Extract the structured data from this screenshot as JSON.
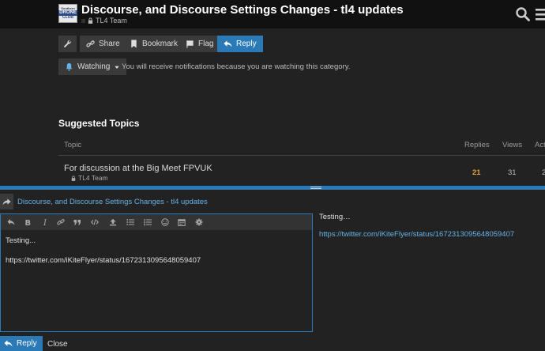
{
  "header": {
    "logo_lines": [
      "Southern",
      "DRONE",
      "CLUB"
    ],
    "title": "Discourse, and Discourse Settings Changes - tl4 updates",
    "category": "TL4 Team"
  },
  "toolbar": {
    "share": "Share",
    "bookmark": "Bookmark",
    "flag": "Flag",
    "reply": "Reply"
  },
  "notifications": {
    "level": "Watching",
    "message": "You will receive notifications because you are watching this category."
  },
  "suggested": {
    "heading": "Suggested Topics",
    "columns": [
      "Topic",
      "Replies",
      "Views",
      "Acti"
    ],
    "rows": [
      {
        "title": "For discussion at the Big Meet FPVUK",
        "category": "TL4 Team",
        "replies": "21",
        "views": "31",
        "activity": "2"
      }
    ]
  },
  "composer": {
    "reply_to": "Discourse, and Discourse Settings Changes - tl4 updates",
    "editor_lines": [
      "Testing...",
      "https://twitter.com/iKiteFlyer/status/1672313095648059407"
    ],
    "preview_text": "Testing…",
    "preview_link": "https://twitter.com/iKiteFlyer/status/1672313095648059407",
    "reply_label": "Reply",
    "close_label": "Close"
  },
  "colors": {
    "accent": "#2a7ab8",
    "link": "#66b2e8",
    "replies_hot": "#e8a13a",
    "background": "#222222",
    "header": "#111111"
  }
}
